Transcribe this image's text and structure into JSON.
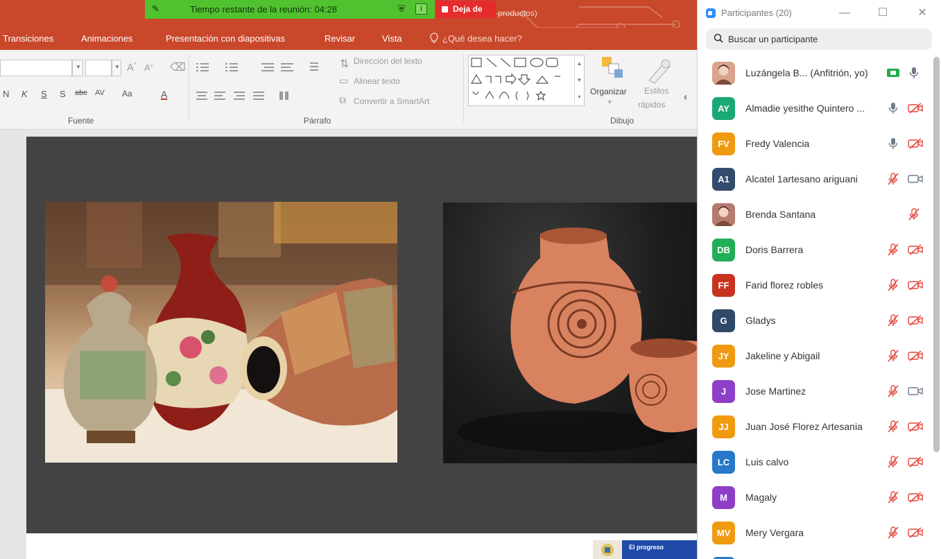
{
  "ppt": {
    "file_title": "productos)",
    "tabs": [
      "Transiciones",
      "Animaciones",
      "Presentación con diapositivas",
      "Revisar",
      "Vista"
    ],
    "tell_me": "¿Qué desea hacer?",
    "groups": {
      "font": "Fuente",
      "paragraph": "Párrafo",
      "drawing": "Dibujo"
    },
    "font_size_placeholder": "",
    "paragraph_cmds": [
      "Dirección del texto",
      "Alinear texto",
      "Convertir a SmartArt"
    ],
    "arrange": "Organizar",
    "quick_styles_line1": "Estilos",
    "quick_styles_line2": "rápidos",
    "format_glyphs": [
      "N",
      "K",
      "S",
      "S",
      "abc",
      "AV",
      "Aa",
      "A"
    ],
    "footer_logo_text": "El progreso"
  },
  "meeting": {
    "timer_text": "Tiempo restante de la reunión: 04:28",
    "leave_label": "Deja de"
  },
  "panel": {
    "title": "Participantes (20)",
    "search_placeholder": "Buscar un participante",
    "participants": [
      {
        "name": "Luzángela B... (Anfitrión, yo)",
        "initials": "",
        "color": "#d9a38c",
        "photo": true,
        "a": "camera-on",
        "b": "mic-on"
      },
      {
        "name": "Almadie yesithe Quintero ...",
        "initials": "AY",
        "color": "#1aa875",
        "a": "mic-on",
        "b": "cam-off"
      },
      {
        "name": "Fredy Valencia",
        "initials": "FV",
        "color": "#f09a12",
        "a": "mic-on",
        "b": "cam-off"
      },
      {
        "name": "Alcatel 1artesano ariguani",
        "initials": "A1",
        "color": "#334b6c",
        "a": "mic-off",
        "b": "cam-on"
      },
      {
        "name": "Brenda Santana",
        "initials": "",
        "color": "#b57b6f",
        "photo": true,
        "a": "",
        "b": "mic-off"
      },
      {
        "name": "Doris Barrera",
        "initials": "DB",
        "color": "#21ae56",
        "a": "mic-off",
        "b": "cam-off"
      },
      {
        "name": "Farid florez robles",
        "initials": "FF",
        "color": "#c8331f",
        "a": "mic-off",
        "b": "cam-off"
      },
      {
        "name": "Gladys",
        "initials": "G",
        "color": "#2f4a68",
        "a": "mic-off",
        "b": "cam-off"
      },
      {
        "name": "Jakeline y Abigail",
        "initials": "JY",
        "color": "#f09a12",
        "a": "mic-off",
        "b": "cam-off"
      },
      {
        "name": "Jose Martinez",
        "initials": "J",
        "color": "#8e3fc7",
        "a": "mic-off",
        "b": "cam-on"
      },
      {
        "name": "Juan José Florez Artesania",
        "initials": "JJ",
        "color": "#f09a12",
        "a": "mic-off",
        "b": "cam-off"
      },
      {
        "name": "Luis calvo",
        "initials": "LC",
        "color": "#2778c8",
        "a": "mic-off",
        "b": "cam-off"
      },
      {
        "name": "Magaly",
        "initials": "M",
        "color": "#8e3fc7",
        "a": "mic-off",
        "b": "cam-off"
      },
      {
        "name": "Mery Vergara",
        "initials": "MV",
        "color": "#f09a12",
        "a": "mic-off",
        "b": "cam-off"
      },
      {
        "name": "",
        "initials": "",
        "color": "#2778c8",
        "a": "",
        "b": ""
      }
    ]
  },
  "colors": {
    "ppt_red": "#c9472a",
    "zoom_green": "#51c22f",
    "leave_red": "#e52c2c",
    "muted_red": "#e5453c"
  }
}
